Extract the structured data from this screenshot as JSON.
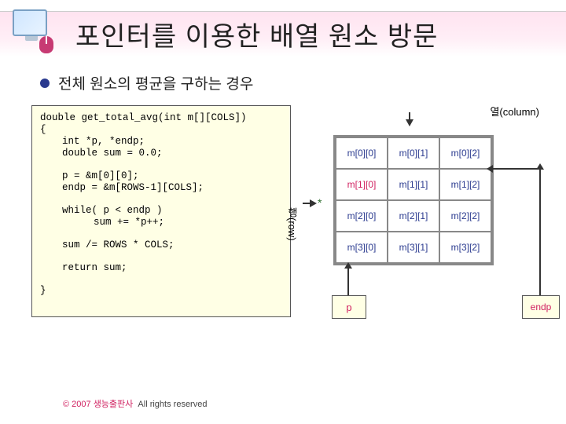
{
  "title": "포인터를 이용한 배열 원소 방문",
  "bullet": "전체 원소의 평균을 구하는 경우",
  "code": {
    "line1": "double get_total_avg(int m[][COLS])",
    "line2": "{",
    "line3": "int *p, *endp;",
    "line4": "double sum = 0.0;",
    "line5": "p = &m[0][0];",
    "line6": "endp = &m[ROWS-1][COLS];",
    "line7": "while( p < endp )",
    "line8": "sum += *p++;",
    "line9": "sum /= ROWS * COLS;",
    "line10": "return sum;",
    "line11": "}"
  },
  "diagram": {
    "col_label": "열(column)",
    "row_label": "행(row)",
    "star_note": "*",
    "cells": [
      [
        "m[0][0]",
        "m[0][1]",
        "m[0][2]"
      ],
      [
        "m[1][0]",
        "m[1][1]",
        "m[1][2]"
      ],
      [
        "m[2][0]",
        "m[2][1]",
        "m[2][2]"
      ],
      [
        "m[3][0]",
        "m[3][1]",
        "m[3][2]"
      ]
    ],
    "p_label": "p",
    "endp_label": "endp"
  },
  "footer": {
    "copyright": "© 2007 생능출판사",
    "rights": "All rights reserved"
  }
}
